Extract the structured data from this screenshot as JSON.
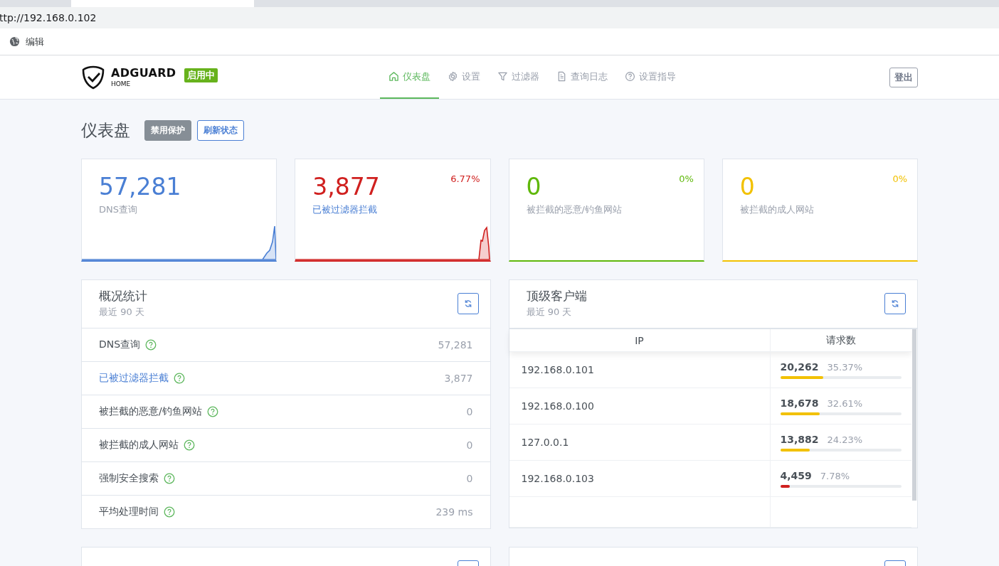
{
  "browser": {
    "address": "ttp://192.168.0.102",
    "bookmarks": [
      {
        "label": "编辑"
      }
    ]
  },
  "header": {
    "logo_title": "ADGUARD",
    "logo_subtitle": "HOME",
    "status_badge": "启用中",
    "nav": [
      {
        "label": "仪表盘",
        "selected": true
      },
      {
        "label": "设置",
        "selected": false
      },
      {
        "label": "过滤器",
        "selected": false
      },
      {
        "label": "查询日志",
        "selected": false
      },
      {
        "label": "设置指导",
        "selected": false
      }
    ],
    "logout": "登出"
  },
  "page": {
    "title": "仪表盘",
    "buttons": [
      {
        "label": "禁用保护",
        "kind": "solid"
      },
      {
        "label": "刷新状态",
        "kind": "outline"
      }
    ]
  },
  "stat_cards": [
    {
      "value": "57,281",
      "label": "DNS查询",
      "color": "#4a7fd4",
      "label_link": false
    },
    {
      "value": "3,877",
      "label": "已被过滤器拦截",
      "percent": "6.77%",
      "color": "#d0201f",
      "label_link": true
    },
    {
      "value": "0",
      "label": "被拦截的恶意/钓鱼网站",
      "percent": "0%",
      "color": "#5fb80a",
      "label_link": false
    },
    {
      "value": "0",
      "label": "被拦截的成人网站",
      "percent": "0%",
      "color": "#f2c100",
      "label_link": false
    }
  ],
  "overview": {
    "title": "概况统计",
    "subtitle": "最近 90 天",
    "rows": [
      {
        "label": "DNS查询",
        "value": "57,281",
        "link": false
      },
      {
        "label": "已被过滤器拦截",
        "value": "3,877",
        "link": true
      },
      {
        "label": "被拦截的恶意/钓鱼网站",
        "value": "0",
        "link": false
      },
      {
        "label": "被拦截的成人网站",
        "value": "0",
        "link": false
      },
      {
        "label": "强制安全搜索",
        "value": "0",
        "link": false
      },
      {
        "label": "平均处理时间",
        "value": "239 ms",
        "link": false
      }
    ]
  },
  "top_clients": {
    "title": "顶级客户端",
    "subtitle": "最近 90 天",
    "columns": [
      "IP",
      "请求数"
    ],
    "rows": [
      {
        "ip": "192.168.0.101",
        "count": "20,262",
        "percent": "35.37%",
        "level": 0.3537,
        "color": "#f2c100"
      },
      {
        "ip": "192.168.0.100",
        "count": "18,678",
        "percent": "32.61%",
        "level": 0.3261,
        "color": "#f2c100"
      },
      {
        "ip": "127.0.0.1",
        "count": "13,882",
        "percent": "24.23%",
        "level": 0.2423,
        "color": "#f2c100"
      },
      {
        "ip": "192.168.0.103",
        "count": "4,459",
        "percent": "7.78%",
        "level": 0.0778,
        "color": "#d0201f"
      }
    ]
  }
}
